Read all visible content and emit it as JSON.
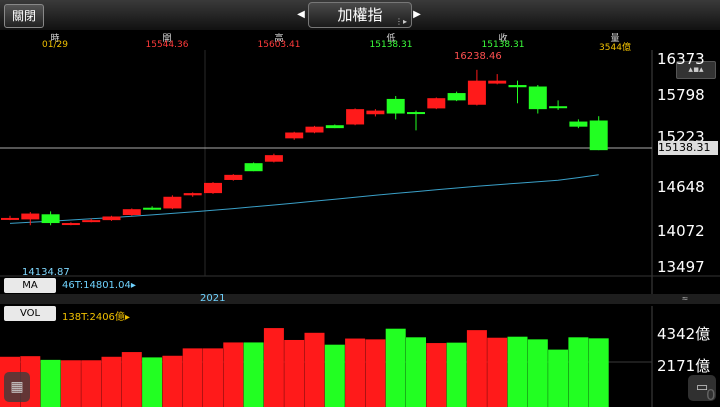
{
  "toolbar": {
    "close_label": "關閉",
    "title": "加權指",
    "prev_icon": "◀",
    "next_icon": "▶",
    "menu_icon": "⋮▶"
  },
  "info": {
    "headers": [
      "時",
      "開",
      "高",
      "低",
      "收",
      "量"
    ],
    "values": [
      "01/29",
      "15544.36",
      "15603.41",
      "15138.31",
      "15138.31",
      "3544億"
    ],
    "colors": [
      "#f0c000",
      "#ff3b3b",
      "#ff3b3b",
      "#3cff3c",
      "#3cff3c",
      "#f0c000"
    ]
  },
  "panel_button": "▴▪▴",
  "price_axis": [
    "16373",
    "15798",
    "15223",
    "14648",
    "14072",
    "13497"
  ],
  "current_price": "15138.31",
  "annotations": {
    "high": "16238.46",
    "low": "14134.87"
  },
  "ma": {
    "label": "MA",
    "value": "46T:14801.04▸"
  },
  "year": "2021",
  "year_button": "≈",
  "volume": {
    "label": "VOL",
    "value": "138T:2406億▸",
    "axis": [
      "4342億",
      "2171億",
      "0"
    ]
  },
  "icons": {
    "grid": "grid-icon",
    "message": "chat-icon"
  },
  "chart_data": {
    "type": "candlestick",
    "candles": [
      {
        "o": 14210,
        "h": 14240,
        "l": 14180,
        "c": 14210,
        "up": true
      },
      {
        "o": 14190,
        "h": 14290,
        "l": 14110,
        "c": 14270,
        "up": true
      },
      {
        "o": 14260,
        "h": 14300,
        "l": 14110,
        "c": 14140,
        "up": false
      },
      {
        "o": 14120,
        "h": 14150,
        "l": 14110,
        "c": 14140,
        "up": true
      },
      {
        "o": 14160,
        "h": 14200,
        "l": 14150,
        "c": 14180,
        "up": true
      },
      {
        "o": 14180,
        "h": 14240,
        "l": 14170,
        "c": 14230,
        "up": true
      },
      {
        "o": 14250,
        "h": 14340,
        "l": 14240,
        "c": 14330,
        "up": true
      },
      {
        "o": 14350,
        "h": 14370,
        "l": 14320,
        "c": 14340,
        "up": false
      },
      {
        "o": 14340,
        "h": 14520,
        "l": 14330,
        "c": 14500,
        "up": true
      },
      {
        "o": 14520,
        "h": 14560,
        "l": 14500,
        "c": 14550,
        "up": true
      },
      {
        "o": 14550,
        "h": 14700,
        "l": 14540,
        "c": 14690,
        "up": true
      },
      {
        "o": 14730,
        "h": 14810,
        "l": 14720,
        "c": 14800,
        "up": true
      },
      {
        "o": 14850,
        "h": 14970,
        "l": 14850,
        "c": 14960,
        "up": false
      },
      {
        "o": 14980,
        "h": 15090,
        "l": 14970,
        "c": 15070,
        "up": true
      },
      {
        "o": 15300,
        "h": 15390,
        "l": 15280,
        "c": 15380,
        "up": true
      },
      {
        "o": 15380,
        "h": 15470,
        "l": 15370,
        "c": 15460,
        "up": true
      },
      {
        "o": 15480,
        "h": 15490,
        "l": 15440,
        "c": 15440,
        "up": false
      },
      {
        "o": 15490,
        "h": 15710,
        "l": 15480,
        "c": 15700,
        "up": true
      },
      {
        "o": 15630,
        "h": 15700,
        "l": 15600,
        "c": 15680,
        "up": true
      },
      {
        "o": 15840,
        "h": 15880,
        "l": 15560,
        "c": 15640,
        "up": false
      },
      {
        "o": 15640,
        "h": 15680,
        "l": 15410,
        "c": 15660,
        "up": false
      },
      {
        "o": 15710,
        "h": 15860,
        "l": 15700,
        "c": 15850,
        "up": true
      },
      {
        "o": 15820,
        "h": 15940,
        "l": 15810,
        "c": 15920,
        "up": false
      },
      {
        "o": 15760,
        "h": 16238.46,
        "l": 15750,
        "c": 16090,
        "up": true
      },
      {
        "o": 16090,
        "h": 16180,
        "l": 16040,
        "c": 16050,
        "up": true
      },
      {
        "o": 16030,
        "h": 16090,
        "l": 15780,
        "c": 16000,
        "up": false
      },
      {
        "o": 16010,
        "h": 16030,
        "l": 15640,
        "c": 15700,
        "up": false
      },
      {
        "o": 15740,
        "h": 15820,
        "l": 15690,
        "c": 15720,
        "up": false
      },
      {
        "o": 15530,
        "h": 15560,
        "l": 15440,
        "c": 15460,
        "up": false
      },
      {
        "o": 15544.36,
        "h": 15603.41,
        "l": 15138.31,
        "c": 15138.31,
        "up": false
      }
    ],
    "ma_line": [
      14134.87,
      14150,
      14166,
      14182,
      14198,
      14215,
      14233,
      14252,
      14272,
      14293,
      14315,
      14338,
      14362,
      14387,
      14413,
      14440,
      14467,
      14494,
      14520,
      14546,
      14571,
      14596,
      14620,
      14643,
      14665,
      14686,
      14706,
      14725,
      14762,
      14801.04
    ],
    "volumes": [
      2450,
      2480,
      2300,
      2280,
      2280,
      2450,
      2680,
      2420,
      2500,
      2860,
      2860,
      3150,
      3150,
      3850,
      3270,
      3620,
      3040,
      3340,
      3300,
      3820,
      3400,
      3120,
      3140,
      3750,
      3380,
      3430,
      3300,
      2800,
      3400,
      3350
    ],
    "y_range": [
      13497,
      16373
    ],
    "vol_max": 4342
  }
}
